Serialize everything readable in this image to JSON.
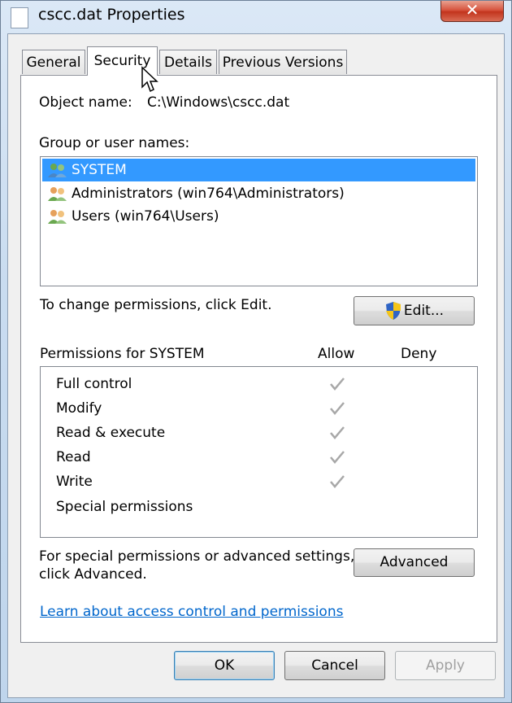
{
  "window": {
    "title": "cscc.dat Properties",
    "close_glyph": "✕"
  },
  "tabs": [
    {
      "label": "General",
      "active": false
    },
    {
      "label": "Security",
      "active": true
    },
    {
      "label": "Details",
      "active": false
    },
    {
      "label": "Previous Versions",
      "active": false
    }
  ],
  "object": {
    "label": "Object name:",
    "value": "C:\\Windows\\cscc.dat"
  },
  "groups": {
    "label": "Group or user names:",
    "items": [
      {
        "name": "SYSTEM",
        "selected": true
      },
      {
        "name": "Administrators (win764\\Administrators)",
        "selected": false
      },
      {
        "name": "Users (win764\\Users)",
        "selected": false
      }
    ]
  },
  "change_text": "To change permissions, click Edit.",
  "edit_button": "Edit...",
  "permissions": {
    "header": "Permissions for SYSTEM",
    "allow_header": "Allow",
    "deny_header": "Deny",
    "rows": [
      {
        "name": "Full control",
        "allow": true,
        "deny": false
      },
      {
        "name": "Modify",
        "allow": true,
        "deny": false
      },
      {
        "name": "Read & execute",
        "allow": true,
        "deny": false
      },
      {
        "name": "Read",
        "allow": true,
        "deny": false
      },
      {
        "name": "Write",
        "allow": true,
        "deny": false
      },
      {
        "name": "Special permissions",
        "allow": false,
        "deny": false
      }
    ]
  },
  "advanced": {
    "text_line1": "For special permissions or advanced settings,",
    "text_line2": "click Advanced.",
    "button": "Advanced"
  },
  "learn_link": "Learn about access control and permissions",
  "footer": {
    "ok": "OK",
    "cancel": "Cancel",
    "apply": "Apply"
  },
  "colors": {
    "selection": "#3399ff",
    "link": "#0066cc",
    "check": "#a8a8a8"
  },
  "icons": {
    "users": "users-icon",
    "shield": "uac-shield-icon",
    "check": "checkmark-icon",
    "cursor": "mouse-cursor-icon"
  }
}
